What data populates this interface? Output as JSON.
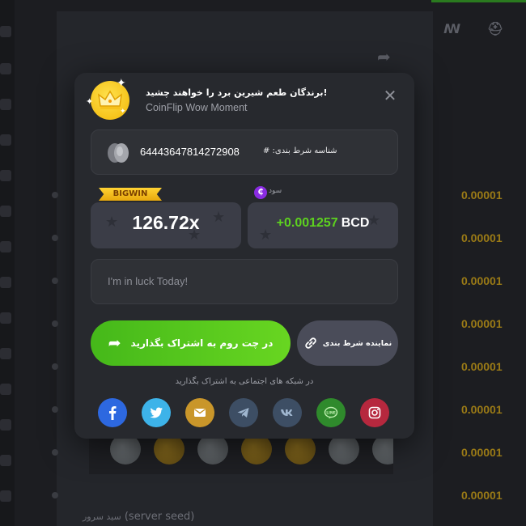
{
  "modal": {
    "title": "!برندگان طعم شیرین برد را خواهند چشید",
    "subtitle": "CoinFlip Wow Moment",
    "close_glyph": "✕",
    "bet_id_label": "شناسه شرط بندی: #",
    "bet_id_value": "64443647814272908",
    "bigwin_label": "BIGWIN",
    "profit_label": "سود",
    "multiplier": "126.72x",
    "profit_amount": "+0.001257",
    "profit_currency": "BCD",
    "message_placeholder": "I'm in luck Today!",
    "share_chat_label": "در چت روم به اشتراک بگذارید",
    "show_bet_label": "نماینده شرط بندی",
    "social_label": "در شبکه های اجتماعی به اشتراک بگذارید",
    "socials": [
      {
        "name": "facebook",
        "icon": "facebook-icon",
        "color": "#2d68e0"
      },
      {
        "name": "twitter",
        "icon": "twitter-icon",
        "color": "#3db3e9"
      },
      {
        "name": "email",
        "icon": "email-icon",
        "color": "#c9962a"
      },
      {
        "name": "telegram",
        "icon": "telegram-icon",
        "color": "#3d4e64"
      },
      {
        "name": "vk",
        "icon": "vk-icon",
        "color": "#3d4e64"
      },
      {
        "name": "line",
        "icon": "line-icon",
        "color": "#2f8a2c"
      },
      {
        "name": "instagram",
        "icon": "instagram-icon",
        "color": "#b6283e"
      }
    ],
    "colors": {
      "green": "#5dd11f",
      "bigwin": "#ffd233",
      "card": "#3b3d47"
    }
  },
  "background": {
    "server_seed_label": "سید سرور",
    "server_seed_paren": "(server seed)",
    "row_values": [
      "0.00001",
      "0.00001",
      "0.00001",
      "0.00001",
      "0.00001",
      "0.00001",
      "0.00001",
      "0.00001"
    ]
  }
}
